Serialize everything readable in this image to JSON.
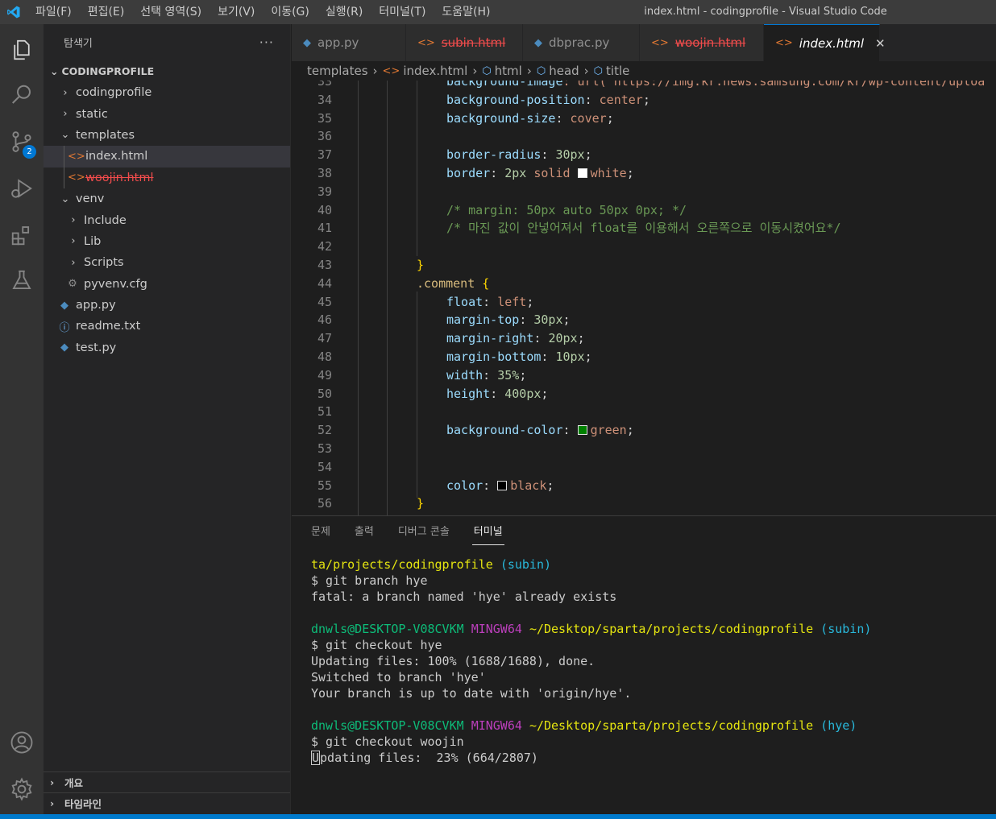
{
  "window": {
    "title": "index.html - codingprofile - Visual Studio Code",
    "menu": [
      "파일(F)",
      "편집(E)",
      "선택 영역(S)",
      "보기(V)",
      "이동(G)",
      "실행(R)",
      "터미널(T)",
      "도움말(H)"
    ]
  },
  "activity_bar": {
    "source_control_badge": "2"
  },
  "sidebar": {
    "title": "탐색기",
    "more": "···",
    "section": "CODINGPROFILE",
    "items": [
      {
        "label": "codingprofile"
      },
      {
        "label": "static"
      },
      {
        "label": "templates"
      },
      {
        "label": "index.html"
      },
      {
        "label": "woojin.html"
      },
      {
        "label": "venv"
      },
      {
        "label": "Include"
      },
      {
        "label": "Lib"
      },
      {
        "label": "Scripts"
      },
      {
        "label": "pyvenv.cfg"
      },
      {
        "label": "app.py"
      },
      {
        "label": "readme.txt"
      },
      {
        "label": "test.py"
      }
    ],
    "outline": "개요",
    "timeline": "타임라인"
  },
  "tabs": [
    {
      "label": "app.py"
    },
    {
      "label": "subin.html"
    },
    {
      "label": "dbprac.py"
    },
    {
      "label": "woojin.html"
    },
    {
      "label": "index.html"
    }
  ],
  "breadcrumb": [
    "templates",
    "index.html",
    "html",
    "head",
    "title"
  ],
  "editor": {
    "line_numbers": [
      "33",
      "34",
      "35",
      "36",
      "37",
      "38",
      "39",
      "40",
      "41",
      "42",
      "43",
      "44",
      "45",
      "46",
      "47",
      "48",
      "49",
      "50",
      "51",
      "52",
      "53",
      "54",
      "55",
      "56"
    ],
    "line33": {
      "prop": "background-image",
      "rest": ": url(\"https://img.kr.news.samsung.com/kr/wp-content/uploa"
    },
    "line34": {
      "prop": "background-position",
      "val": "center"
    },
    "line35": {
      "prop": "background-size",
      "val": "cover"
    },
    "line37": {
      "prop": "border-radius",
      "num": "30px"
    },
    "line38": {
      "prop": "border",
      "num": "2px",
      "val1": "solid",
      "color": "white"
    },
    "line40": "/* margin: 50px auto 50px 0px; */",
    "line41": "/* 마진 값이 안넣어져서 float를 이용해서 오른쪽으로 이동시켰어요*/",
    "line43": "}",
    "line44": ".comment",
    "line45": {
      "prop": "float",
      "val": "left"
    },
    "line46": {
      "prop": "margin-top",
      "num": "30px"
    },
    "line47": {
      "prop": "margin-right",
      "num": "20px"
    },
    "line48": {
      "prop": "margin-bottom",
      "num": "10px"
    },
    "line49": {
      "prop": "width",
      "num": "35%"
    },
    "line50": {
      "prop": "height",
      "num": "400px"
    },
    "line52": {
      "prop": "background-color",
      "color": "green"
    },
    "line55": {
      "prop": "color",
      "color": "black"
    },
    "line56": "}",
    "colors": {
      "white": "#ffffff",
      "green": "#008000",
      "black": "#000000"
    }
  },
  "panel": {
    "tabs": [
      "문제",
      "출력",
      "디버그 콘솔",
      "터미널"
    ],
    "terminal": {
      "l1_path": "ta/projects/codingprofile",
      "l1_branch": "(subin)",
      "l2": "$ git branch hye",
      "l3": "fatal: a branch named 'hye' already exists",
      "p2_user": "dnwls@DESKTOP-V08CVKM",
      "p2_env": "MINGW64",
      "p2_path": "~/Desktop/sparta/projects/codingprofile",
      "p2_branch": "(subin)",
      "l5": "$ git checkout hye",
      "l6": "Updating files: 100% (1688/1688), done.",
      "l7": "Switched to branch 'hye'",
      "l8": "Your branch is up to date with 'origin/hye'.",
      "p3_user": "dnwls@DESKTOP-V08CVKM",
      "p3_env": "MINGW64",
      "p3_path": "~/Desktop/sparta/projects/codingprofile",
      "p3_branch": "(hye)",
      "l10": "$ git checkout woojin",
      "l11_first": "U",
      "l11_rest": "pdating files:  23% (664/2807)"
    }
  }
}
